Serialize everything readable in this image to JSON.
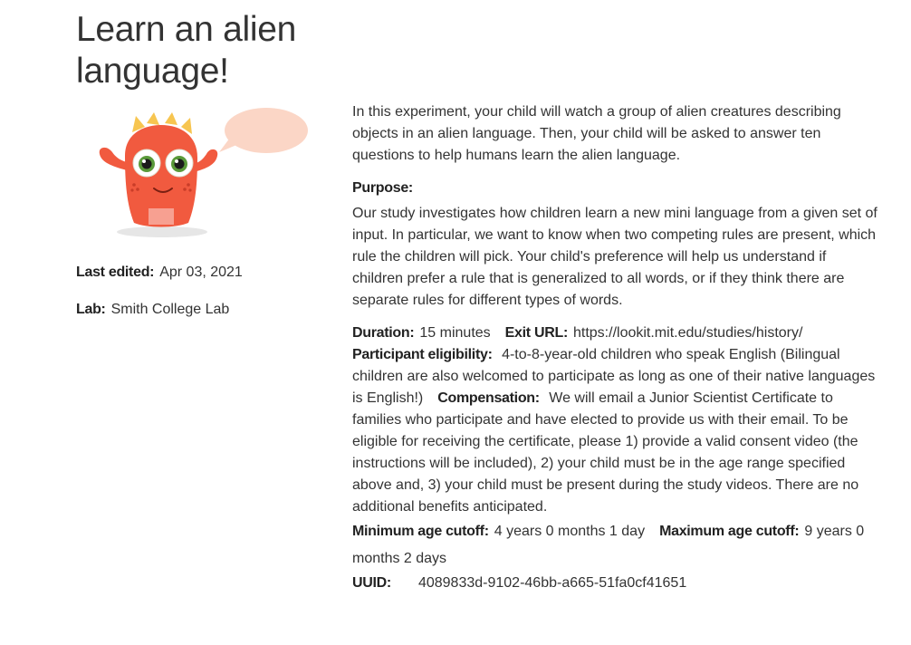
{
  "study": {
    "title": "Learn an alien language!",
    "last_edited_label": "Last edited:",
    "last_edited_value": "Apr 03, 2021",
    "lab_label": "Lab:",
    "lab_value": "Smith College Lab",
    "description": "In this experiment, your child will watch a group of alien creatures describing objects in an alien language. Then, your child will be asked to answer ten questions to help humans learn the alien language.",
    "purpose_label": "Purpose:",
    "purpose_text": "Our study investigates how children learn a new mini language from a given set of input. In particular, we want to know when two competing rules are present, which rule the children will pick. Your child's preference will help us understand if children prefer a rule that is generalized to all words, or if they think there are separate rules for different types of words.",
    "duration_label": "Duration:",
    "duration_value": "15 minutes",
    "exit_url_label": "Exit URL:",
    "exit_url_value": "https://lookit.mit.edu/studies/history/",
    "eligibility_label": "Participant eligibility:",
    "eligibility_value": "4-to-8-year-old children who speak English (Bilingual children are also welcomed to participate as long as one of their native languages is English!)",
    "compensation_label": "Compensation:",
    "compensation_value": "We will email a Junior Scientist Certificate to families who participate and have elected to provide us with their email. To be eligible for receiving the certificate, please 1) provide a valid consent video (the instructions will be included), 2) your child must be in the age range specified above and, 3) your child must be present during the study videos. There are no additional benefits anticipated.",
    "min_age_label": "Minimum age cutoff:",
    "min_age_value": "4 years 0 months 1 day",
    "max_age_label": "Maximum age cutoff:",
    "max_age_value": "9 years 0 months 2 days",
    "uuid_label": "UUID:",
    "uuid_value": "4089833d-9102-46bb-a665-51fa0cf41651"
  },
  "colors": {
    "monster_body": "#f15a3f",
    "monster_spikes": "#f7c550",
    "speech_bubble": "#fbd6c6"
  },
  "icons": {
    "mascot": "alien-monster-illustration"
  }
}
